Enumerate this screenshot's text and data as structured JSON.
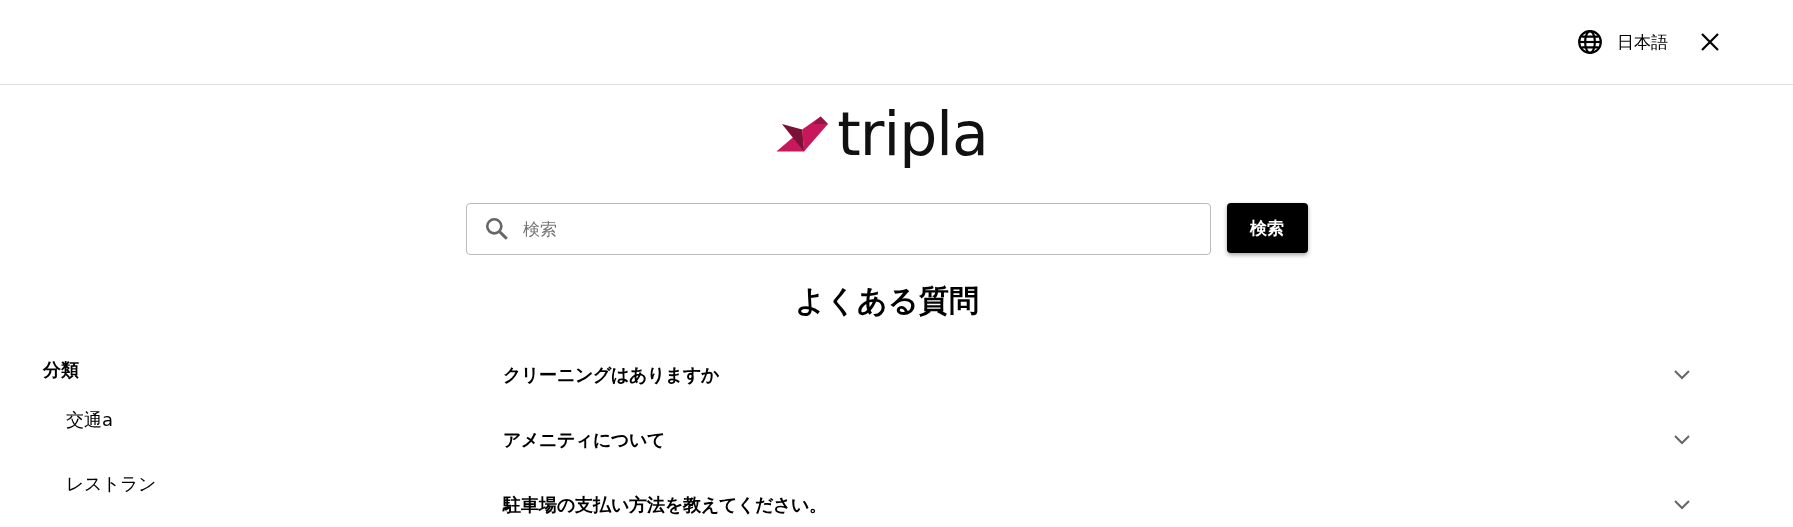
{
  "header": {
    "language": "日本語"
  },
  "logo": {
    "text": "tripla"
  },
  "search": {
    "placeholder": "検索",
    "button": "検索"
  },
  "title": "よくある質問",
  "sidebar": {
    "heading": "分類",
    "items": [
      {
        "label": "交通a"
      },
      {
        "label": "レストラン"
      }
    ]
  },
  "faq": [
    {
      "question": "クリーニングはありますか",
      "expanded": false
    },
    {
      "question": "アメニティについて",
      "expanded": false
    },
    {
      "question": "駐車場の支払い方法を教えてください。",
      "expanded": false
    }
  ]
}
